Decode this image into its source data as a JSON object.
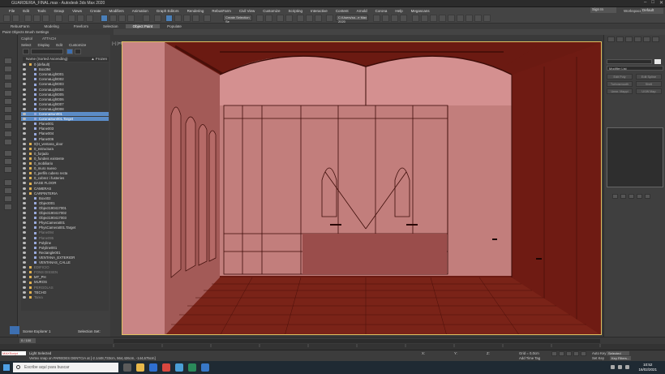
{
  "window": {
    "title": "GUARDERIA_FINAL.max - Autodesk 3ds Max 2020"
  },
  "menu": [
    "File",
    "Edit",
    "Tools",
    "Group",
    "Views",
    "Create",
    "Modifiers",
    "Animation",
    "Graph Editors",
    "Rendering",
    "RebusFarm",
    "Civil View",
    "Customize",
    "Scripting",
    "Interactive",
    "Content",
    "Arnold",
    "Corona",
    "Help",
    "Megascans"
  ],
  "menu_right": {
    "signin": "Sign In",
    "workspaces_label": "Workspaces:",
    "workspaces_value": "Default"
  },
  "toolbar": {
    "selection_set": "Create Selection Se",
    "render_preset": "C:/Users/sa...e Max 2020"
  },
  "ribbon": {
    "tabs": [
      "RebusFarm",
      "Modeling",
      "Freeform",
      "Selection",
      "Object Paint",
      "Populate"
    ],
    "active": "Object Paint",
    "sub": "Paint Objects   Brush Settings"
  },
  "left_labels": {
    "toolbar_a": "Capitol",
    "toolbar_b": "ATTACH"
  },
  "scene_explorer": {
    "tabs": [
      "Select",
      "Display",
      "Edit",
      "Customize"
    ],
    "column_header": "Name (Sorted Ascending)",
    "frozen_label": "▲ Frozen",
    "rows": [
      {
        "t": "0 (default)",
        "lvl": 0,
        "k": "layer"
      },
      {
        "t": "Box394",
        "lvl": 1,
        "k": "obj"
      },
      {
        "t": "CoronaLight001",
        "lvl": 1,
        "k": "obj"
      },
      {
        "t": "CoronaLight002",
        "lvl": 1,
        "k": "obj"
      },
      {
        "t": "CoronaLight003",
        "lvl": 1,
        "k": "obj"
      },
      {
        "t": "CoronaLight004",
        "lvl": 1,
        "k": "obj"
      },
      {
        "t": "CoronaLight005",
        "lvl": 1,
        "k": "obj"
      },
      {
        "t": "CoronaLight006",
        "lvl": 1,
        "k": "obj"
      },
      {
        "t": "CoronaLight007",
        "lvl": 1,
        "k": "obj"
      },
      {
        "t": "CoronaLight008",
        "lvl": 1,
        "k": "obj"
      },
      {
        "t": "CoronaSun001",
        "lvl": 1,
        "k": "obj",
        "sel": true
      },
      {
        "t": "CoronaSun001.Target",
        "lvl": 1,
        "k": "obj",
        "sel": true
      },
      {
        "t": "Plane001",
        "lvl": 1,
        "k": "obj"
      },
      {
        "t": "Plane003",
        "lvl": 1,
        "k": "obj"
      },
      {
        "t": "Plane004",
        "lvl": 1,
        "k": "obj"
      },
      {
        "t": "Plane006",
        "lvl": 1,
        "k": "obj"
      },
      {
        "t": "0(H_ventana_door",
        "lvl": 0,
        "k": "layer"
      },
      {
        "t": "0_estructura",
        "lvl": 0,
        "k": "layer"
      },
      {
        "t": "0_forjado",
        "lvl": 0,
        "k": "layer"
      },
      {
        "t": "0_fundeis existente",
        "lvl": 0,
        "k": "layer"
      },
      {
        "t": "0_mobiliario",
        "lvl": 0,
        "k": "layer"
      },
      {
        "t": "0_muro nuevo",
        "lvl": 0,
        "k": "layer"
      },
      {
        "t": "0_perfils cubero recta",
        "lvl": 0,
        "k": "layer"
      },
      {
        "t": "0_cobrez i fusteries",
        "lvl": 0,
        "k": "layer"
      },
      {
        "t": "BASE FLOOR",
        "lvl": 0,
        "k": "layer"
      },
      {
        "t": "CAMERAS",
        "lvl": 0,
        "k": "layer"
      },
      {
        "t": "CARPINTERIA",
        "lvl": 0,
        "k": "layer"
      },
      {
        "t": "Box402",
        "lvl": 1,
        "k": "obj"
      },
      {
        "t": "Object001",
        "lvl": 1,
        "k": "obj"
      },
      {
        "t": "Object190417001",
        "lvl": 1,
        "k": "obj"
      },
      {
        "t": "Object190417002",
        "lvl": 1,
        "k": "obj"
      },
      {
        "t": "Object190417003",
        "lvl": 1,
        "k": "obj"
      },
      {
        "t": "PhysCamera001",
        "lvl": 1,
        "k": "obj"
      },
      {
        "t": "PhysCamera001.Target",
        "lvl": 1,
        "k": "obj"
      },
      {
        "t": "Plane094",
        "lvl": 1,
        "k": "obj",
        "dim": true
      },
      {
        "t": "Plane095",
        "lvl": 1,
        "k": "obj",
        "dim": true
      },
      {
        "t": "Polyline",
        "lvl": 1,
        "k": "obj"
      },
      {
        "t": "Polyline001",
        "lvl": 1,
        "k": "obj"
      },
      {
        "t": "Rectangle001",
        "lvl": 1,
        "k": "obj"
      },
      {
        "t": "VENTANA_EXTERIOR",
        "lvl": 1,
        "k": "obj"
      },
      {
        "t": "VENTANAS_CALLE",
        "lvl": 1,
        "k": "obj"
      },
      {
        "t": "EDIFICIO",
        "lvl": 0,
        "k": "layer",
        "dim": true
      },
      {
        "t": "FONS DISSEN",
        "lvl": 0,
        "k": "layer",
        "dim": true
      },
      {
        "t": "MT_PH",
        "lvl": 0,
        "k": "layer"
      },
      {
        "t": "MUROS",
        "lvl": 0,
        "k": "layer"
      },
      {
        "t": "PERGOLAS",
        "lvl": 0,
        "k": "layer",
        "dim": true
      },
      {
        "t": "TECHO",
        "lvl": 0,
        "k": "layer"
      },
      {
        "t": "Tarea",
        "lvl": 0,
        "k": "layer",
        "dim": true
      }
    ],
    "footer": {
      "explorer": "Scene Explorer 1",
      "selection_set": "Selection Set:"
    }
  },
  "viewport": {
    "label": "[+] [PhysCamera001] [User Defined] [Standard] [Edged Faces]"
  },
  "right_panel": {
    "modifier_list": "Modifier List",
    "buttons": [
      "Edit Poly",
      "Edit Spline",
      "Turbosmooth",
      "Shell",
      "Unwr. Mappi",
      "UVW Map"
    ]
  },
  "timeslider": {
    "frame": "0 / 100"
  },
  "status": {
    "maxscript": "MAXScript",
    "line1": "Light Selected",
    "line2": "Vertex snap on PAREDES DENTCIA at [-2.1448,733cm, 564,426cm, -144,675cm]",
    "x_label": "X:",
    "x_val": "",
    "y_label": "Y:",
    "y_val": "",
    "z_label": "Z:",
    "z_val": "",
    "grid": "Grid = 0,0cm",
    "add_time_tag": "Add Time Tag",
    "auto_key": "Auto Key",
    "auto_key_value": "Selected",
    "set_key": "Set Key",
    "key_filters": "Key Filters..."
  },
  "taskbar": {
    "search_placeholder": "Escribe aquí para buscar",
    "time": "10:52",
    "date": "16/02/2021"
  },
  "colors": {
    "viewport_bg": "#6a1810",
    "wall_pink": "#d08c8c",
    "selection": "#5b8cc7",
    "accent_blue": "#3d6fb0"
  }
}
